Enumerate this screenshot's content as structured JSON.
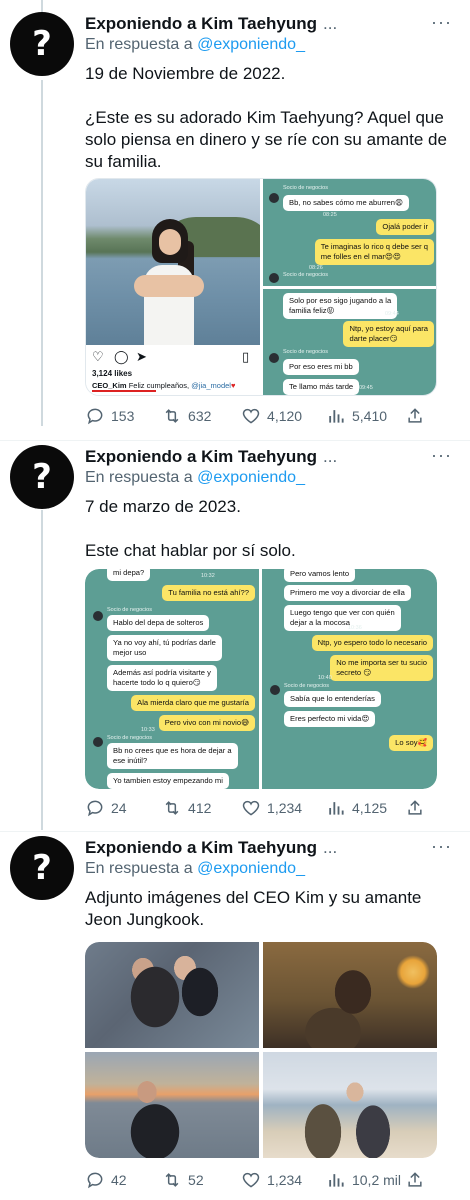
{
  "tweets": [
    {
      "author_name": "Exponiendo a Kim Taehyung",
      "name_ellipsis": "...",
      "avatar_glyph": "?",
      "more_glyph": "···",
      "reply_prefix": "En respuesta a",
      "reply_handle": "@exponiendo_",
      "text": "19 de Noviembre de 2022.\n\n¿Este es su adorado Kim Taehyung? Aquel que solo piensa en dinero y se ríe con su amante de su familia.",
      "actions": {
        "replies": "153",
        "retweets": "632",
        "likes": "4,120",
        "views": "5,410"
      }
    },
    {
      "author_name": "Exponiendo a Kim Taehyung",
      "name_ellipsis": "...",
      "avatar_glyph": "?",
      "more_glyph": "···",
      "reply_prefix": "En respuesta a",
      "reply_handle": "@exponiendo_",
      "text": "7 de marzo de 2023.\n\nEste chat hablar por sí solo.",
      "actions": {
        "replies": "24",
        "retweets": "412",
        "likes": "1,234",
        "views": "4,125"
      }
    },
    {
      "author_name": "Exponiendo a Kim Taehyung",
      "name_ellipsis": "...",
      "avatar_glyph": "?",
      "more_glyph": "···",
      "reply_prefix": "En respuesta a",
      "reply_handle": "@exponiendo_",
      "text": "Adjunto imágenes del CEO Kim y su amante Jeon Jungkook.",
      "actions": {
        "replies": "42",
        "retweets": "52",
        "likes": "1,234",
        "views": "10,2 mil"
      }
    }
  ],
  "instagram": {
    "likes": "3,124 likes",
    "caption_user": "CEO_Kim",
    "caption_text": "Feliz cumpleaños,",
    "caption_tag": "@jia_model",
    "caption_heart": "♥"
  },
  "chat1": {
    "sender": "Socio de negocios",
    "m1": "Bb, no sabes cómo me aburren😩",
    "m2": "Ojalá poder ir",
    "m3": "Te imaginas lo rico q debe ser q",
    "m3b": "me folles en el mar😍😍",
    "t1": "08:25",
    "t2": "08:26"
  },
  "chat2": {
    "m1": "Solo por eso sigo jugando a la",
    "m1b": "familia feliz😝",
    "m2": "Ntp, yo estoy aquí para",
    "m2b": "darte placer😏",
    "sender": "Socio de negocios",
    "m3": "Por eso eres mi bb",
    "m4": "Te llamo más tarde",
    "t1": "09:44",
    "t2": "09:45"
  },
  "chat3": {
    "m0": "mi depa?",
    "m1": "Tu familia no está ahí??",
    "sender": "Socio de negocios",
    "m2": "Hablo del depa de solteros",
    "m3": "Ya no voy ahí, tú podrías darle",
    "m3b": "mejor uso",
    "m4": "Además así podría visitarte y",
    "m4b": "hacerte todo lo q quiero😏",
    "m5": "Ala mierda claro que me gustaría",
    "m6": "Pero vivo con mi novio😅",
    "sender2": "Socio de negocios",
    "m7": "Bb no crees que es hora de dejar a",
    "m7b": "ese inútil?",
    "m8": "Yo tambien estoy empezando mi",
    "t1": "10:32",
    "t2": "10:33"
  },
  "chat4": {
    "m1": "Pero vamos lento",
    "m2": "Primero me voy a divorciar de ella",
    "m3": "Luego tengo que ver con quién",
    "m3b": "dejar a la mocosa",
    "m4": "Ntp, yo espero todo lo necesario",
    "m5": "No me importa ser tu sucio",
    "m5b": "secreto 😏",
    "sender": "Socio de negocios",
    "m6": "Sabía que lo entenderías",
    "m7": "Eres perfecto mi vida😍",
    "m8": "Lo soy🥰",
    "t1": "10:36",
    "t2": "10:40"
  },
  "colors": {
    "accent": "#1d9bf0",
    "chat_bg": "#5d9e94",
    "bubble_out": "#fbe566",
    "bubble_in": "#ffffff",
    "muted": "#536471"
  }
}
